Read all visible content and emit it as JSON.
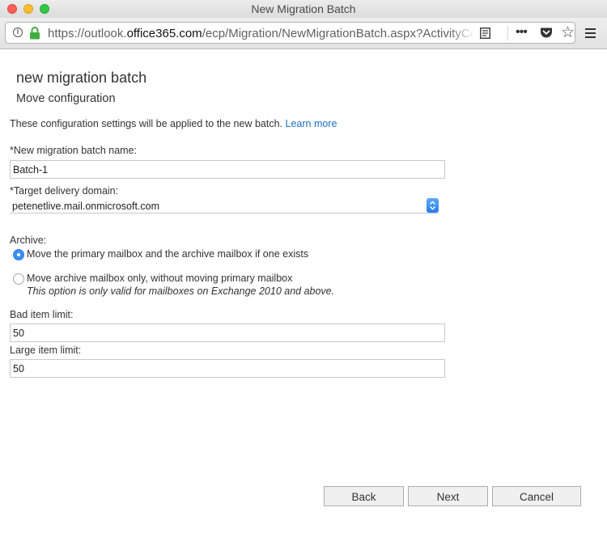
{
  "window": {
    "title": "New Migration Batch"
  },
  "browser": {
    "url_prefix": "https://outlook.",
    "url_domain": "office365.com",
    "url_path": "/ecp/Migration/NewMigrationBatch.aspx?ActivityCor",
    "icons": [
      "info-icon",
      "lock-icon",
      "reader-view-icon",
      "more-icon",
      "pocket-icon",
      "bookmark-star-icon",
      "menu-icon"
    ],
    "more_glyph": "•••",
    "star_glyph": "☆"
  },
  "page": {
    "title": "new migration batch",
    "subtitle": "Move configuration",
    "intro_text": "These configuration settings will be applied to the new batch.",
    "intro_link": "Learn more"
  },
  "form": {
    "batch_name_label": "*New migration batch name:",
    "batch_name_value": "Batch-1",
    "target_domain_label": "*Target delivery domain:",
    "target_domain_value": "petenetlive.mail.onmicrosoft.com",
    "archive_label": "Archive:",
    "archive_options": [
      {
        "label": "Move the primary mailbox and the archive mailbox if one exists",
        "selected": true
      },
      {
        "label": "Move archive mailbox only, without moving primary mailbox",
        "selected": false
      }
    ],
    "archive_note": "This option is only valid for mailboxes on Exchange 2010 and above.",
    "bad_item_label": "Bad item limit:",
    "bad_item_value": "50",
    "large_item_label": "Large item limit:",
    "large_item_value": "50"
  },
  "buttons": {
    "back": "Back",
    "next": "Next",
    "cancel": "Cancel"
  },
  "colors": {
    "link": "#1e6fc6",
    "radio_selected": "#3b8ff3",
    "lock": "#3fae3f"
  }
}
